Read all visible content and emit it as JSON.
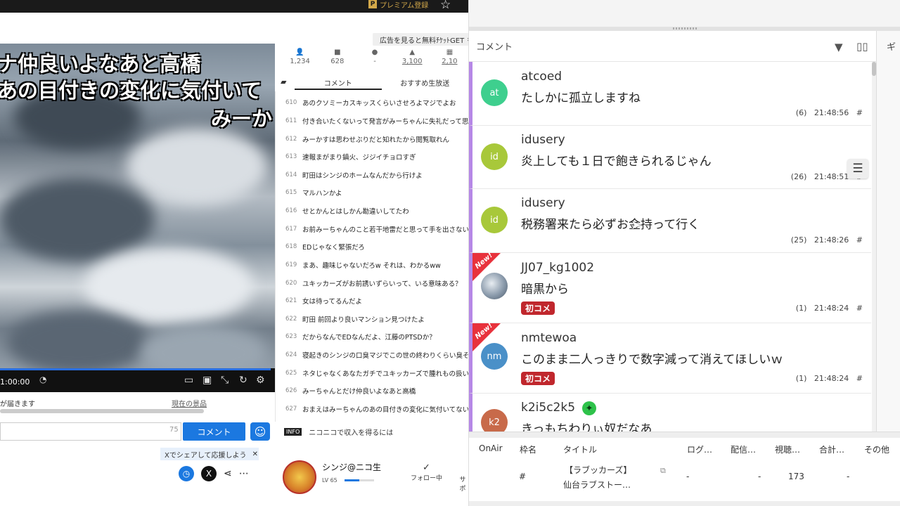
{
  "topbar": {
    "premium_label": "プレミアム登録",
    "premium_badge": "P"
  },
  "ad_chip": {
    "label": "広告を見ると無料ﾁｹｯﾄGET"
  },
  "player": {
    "overlay_lines": [
      "ナ仲良いよなあと高橋",
      "あの目付きの変化に気付いて",
      "みーか"
    ],
    "time": "1:00:00"
  },
  "gift": {
    "left_text": "が届きます",
    "right_text": "現在の景品"
  },
  "comment_form": {
    "char_count": "75",
    "submit_label": "コメント"
  },
  "share": {
    "tooltip": "Xでシェアして応援しよう",
    "x_label": "X"
  },
  "stats": [
    {
      "icon": "person-icon",
      "glyph": "👤",
      "value": "1,234"
    },
    {
      "icon": "comment-icon",
      "glyph": "■",
      "value": "628"
    },
    {
      "icon": "clock-icon",
      "glyph": "●",
      "value": "-"
    },
    {
      "icon": "ad-icon",
      "glyph": "▲",
      "value": "3,100"
    },
    {
      "icon": "gift-icon",
      "glyph": "▦",
      "value": "2,10"
    }
  ],
  "list_tabs": [
    "コメント",
    "おすすめ生放送"
  ],
  "comment_list": [
    {
      "no": "610",
      "text": "あのクソミーカスキッスくらいさせろよマジでよお"
    },
    {
      "no": "611",
      "text": "付き合いたくないって発言がみーちゃんに失礼だって思"
    },
    {
      "no": "612",
      "text": "みーかすは思わせぶりだと知れたから閲覧取れん"
    },
    {
      "no": "613",
      "text": "速報まがまり鎮火、ジジイチョロすぎ"
    },
    {
      "no": "614",
      "text": "町田はシンジのホームなんだから行けよ"
    },
    {
      "no": "615",
      "text": "マルハンかよ"
    },
    {
      "no": "616",
      "text": "せとかんとはしかん勘違いしてたわ"
    },
    {
      "no": "617",
      "text": "お前みーちゃんのこと若干地雷だと思って手を出さない"
    },
    {
      "no": "618",
      "text": "EDじゃなく緊張だろ"
    },
    {
      "no": "619",
      "text": "まあ、趣味じゃないだろw それは、わかるww"
    },
    {
      "no": "620",
      "text": "ユキッカーズがお前誘いずらいって、いる意味ある？"
    },
    {
      "no": "621",
      "text": "女は待ってるんだよ"
    },
    {
      "no": "622",
      "text": "町田 前回より良いマンション見つけたよ"
    },
    {
      "no": "623",
      "text": "だからなんでEDなんだよ、江藤のPTSDか？"
    },
    {
      "no": "624",
      "text": "寝起きのシンジの口臭マジでこの世の終わりくらい臭そ"
    },
    {
      "no": "625",
      "text": "ネタじゃなくあなたガチでユキッカーズで腫れもの扱い"
    },
    {
      "no": "626",
      "text": "みーちゃんとだけ仲良いよなあと高橋"
    },
    {
      "no": "627",
      "text": "おまえはみーちゃんのあの目付きの変化に気付いてない"
    }
  ],
  "info_row": {
    "badge": "INFO",
    "text": "ニコニコで収入を得るには"
  },
  "profile": {
    "name": "シンジ@ニコ生",
    "level": "LV 65",
    "follow_label": "フォロー中",
    "follow_icon": "check-icon",
    "extra_label": "サポ"
  },
  "viewer": {
    "panel_title": "コメント",
    "side_label": "ギ",
    "comments": [
      {
        "avatar_text": "at",
        "avatar_color": "#3ecf8e",
        "user": "atcoed",
        "text": "たしかに孤立しますね",
        "count": "(6)",
        "time": "21:48:56",
        "mark": "#",
        "is_new": false,
        "first": ""
      },
      {
        "avatar_text": "id",
        "avatar_color": "#a8c83a",
        "user": "idusery",
        "text": "炎上しても１日で飽きられるじゃん",
        "count": "(26)",
        "time": "21:48:51",
        "mark": "#",
        "is_new": false,
        "first": ""
      },
      {
        "avatar_text": "id",
        "avatar_color": "#a8c83a",
        "user": "idusery",
        "text": "税務署来たら必ずお金持って行く",
        "count": "(25)",
        "time": "21:48:26",
        "mark": "#",
        "is_new": false,
        "first": ""
      },
      {
        "avatar_text": "",
        "avatar_color": "#7a8a9c",
        "user": "JJ07_kg1002",
        "text": "暗黒から",
        "count": "(1)",
        "time": "21:48:24",
        "mark": "#",
        "is_new": true,
        "new_label": "New!",
        "first": "初コメ"
      },
      {
        "avatar_text": "nm",
        "avatar_color": "#4a90c8",
        "user": "nmtewoa",
        "text": "このまま二人っきりで数字減って消えてほしいｗ",
        "count": "(1)",
        "time": "21:48:24",
        "mark": "#",
        "is_new": true,
        "new_label": "New!",
        "first": "初コメ"
      },
      {
        "avatar_text": "k2",
        "avatar_color": "#c86a4a",
        "user": "k2i5c2k5",
        "text": "きっもちわりぃ奴だなあ",
        "count": "",
        "time": "",
        "mark": "",
        "is_new": false,
        "first": ""
      }
    ],
    "table": {
      "headers": [
        "OnAir",
        "枠名",
        "タイトル",
        "ログ…",
        "配信…",
        "視聴…",
        "合計…",
        "その他"
      ],
      "row": {
        "frame": "#",
        "title_line1": "【ラブッカーズ】",
        "title_line2": "仙台ラブストー…",
        "log": "-",
        "stream": "-",
        "viewers": "173",
        "total": "-"
      }
    }
  }
}
